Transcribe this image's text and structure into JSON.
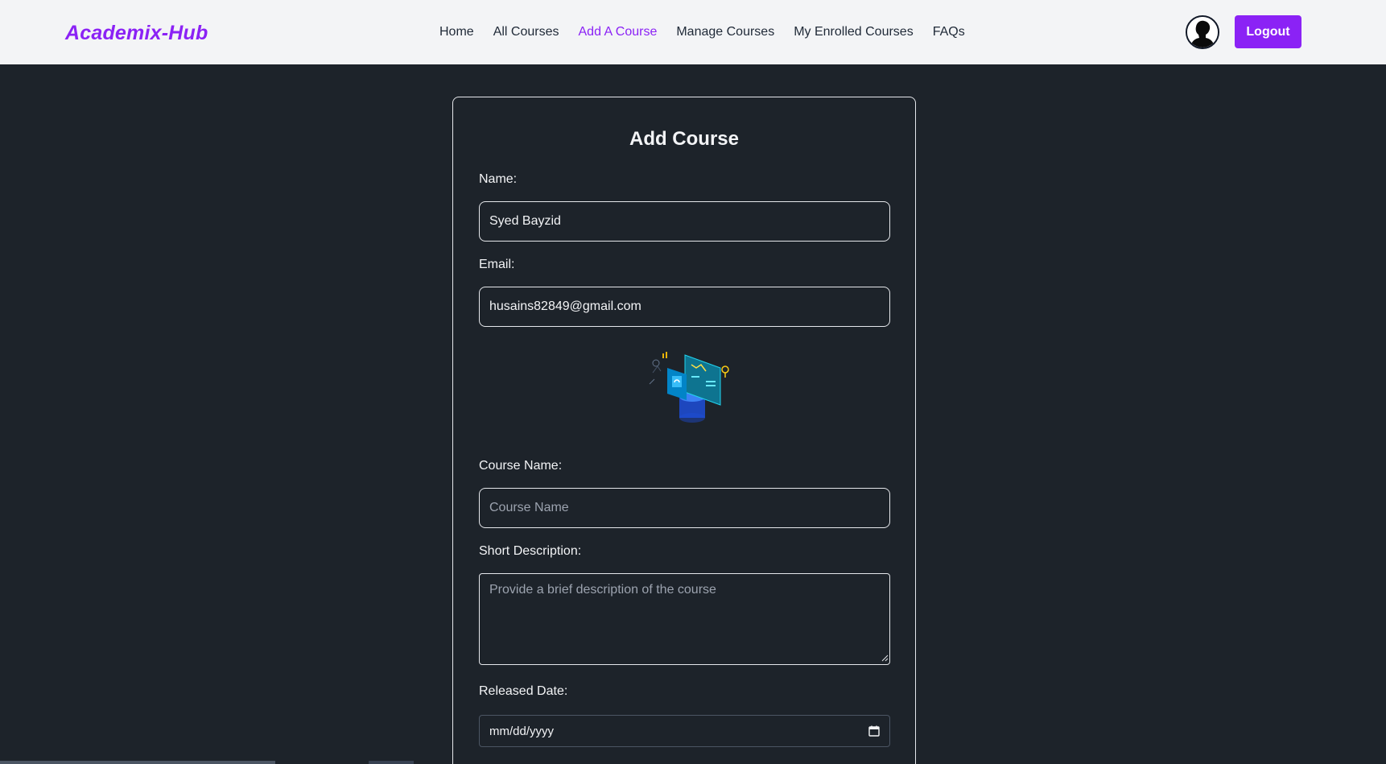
{
  "brand": {
    "logo": "Academix-Hub",
    "accent_color": "#8b22f5"
  },
  "nav": {
    "links": [
      {
        "label": "Home"
      },
      {
        "label": "All Courses"
      },
      {
        "label": "Add A Course",
        "active": true
      },
      {
        "label": "Manage Courses"
      },
      {
        "label": "My Enrolled Courses"
      },
      {
        "label": "FAQs"
      }
    ],
    "logout_label": "Logout",
    "avatar_icon": "user-avatar"
  },
  "form": {
    "title": "Add Course",
    "name": {
      "label": "Name:",
      "value": "Syed Bayzid"
    },
    "email": {
      "label": "Email:",
      "value": "husains82849@gmail.com"
    },
    "illustration_icon": "isometric-online-learning-illustration",
    "course_name": {
      "label": "Course Name:",
      "placeholder": "Course Name",
      "value": ""
    },
    "short_description": {
      "label": "Short Description:",
      "placeholder": "Provide a brief description of the course",
      "value": ""
    },
    "released_date": {
      "label": "Released Date:",
      "placeholder": "mm/dd/yyyy",
      "icon": "calendar-icon"
    }
  }
}
